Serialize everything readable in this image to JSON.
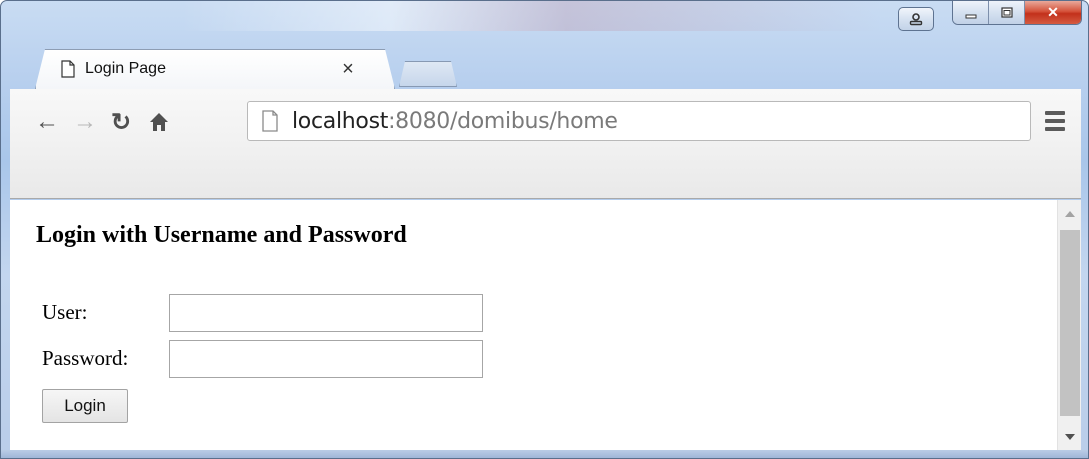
{
  "window": {
    "controls": {
      "user_icon": "user-icon",
      "minimize_icon": "minimize-icon",
      "maximize_icon": "maximize-icon",
      "close_glyph": "✕"
    },
    "colors": {
      "close": "#c7341b",
      "frame": "#b7cfee"
    }
  },
  "tabs": [
    {
      "title": "Login Page",
      "close_glyph": "×",
      "active": true
    }
  ],
  "toolbar": {
    "back_glyph": "←",
    "forward_glyph": "→",
    "reload_glyph": "↻",
    "home_glyph": "⌂",
    "url_host": "localhost",
    "url_rest": ":8080/domibus/home"
  },
  "page": {
    "heading": "Login with Username and Password",
    "form": {
      "user_label": "User:",
      "user_value": "",
      "password_label": "Password:",
      "password_value": "",
      "login_button": "Login"
    }
  }
}
